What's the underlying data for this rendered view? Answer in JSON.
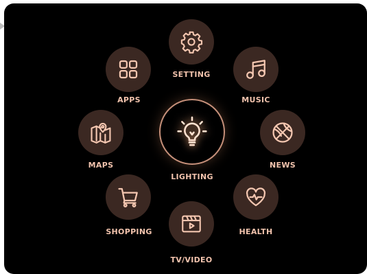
{
  "theme": {
    "background": "#000000",
    "tile": "#3b2822",
    "icon": "#f4c6b0",
    "label": "#f2c3ad",
    "ring": "#c6907a"
  },
  "center": {
    "label": "LIGHTING",
    "icon": "lightbulb-icon"
  },
  "items": [
    {
      "id": "setting",
      "label": "SETTING",
      "icon": "gear-icon"
    },
    {
      "id": "music",
      "label": "MUSIC",
      "icon": "music-note-icon"
    },
    {
      "id": "news",
      "label": "NEWS",
      "icon": "basketball-icon"
    },
    {
      "id": "health",
      "label": "HEALTH",
      "icon": "heart-pulse-icon"
    },
    {
      "id": "tv-video",
      "label": "TV/VIDEO",
      "icon": "video-player-icon"
    },
    {
      "id": "shopping",
      "label": "SHOPPING",
      "icon": "shopping-cart-icon"
    },
    {
      "id": "maps",
      "label": "MAPS",
      "icon": "map-pin-icon"
    },
    {
      "id": "apps",
      "label": "APPS",
      "icon": "apps-grid-icon"
    }
  ]
}
